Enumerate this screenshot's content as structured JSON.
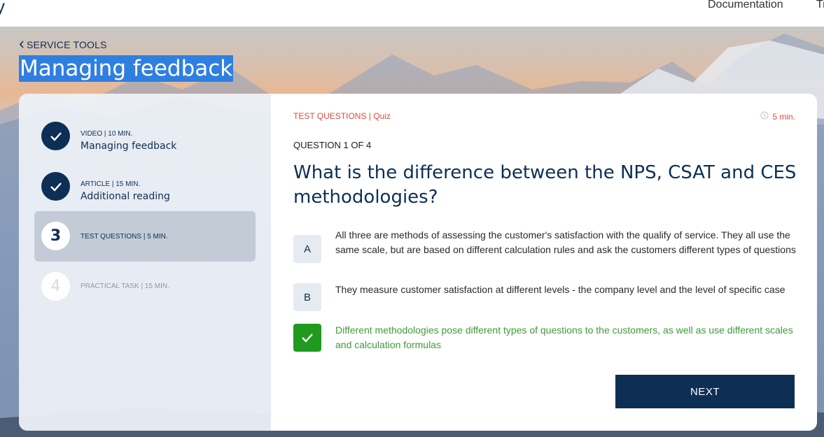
{
  "header": {
    "logo_fragment": "y",
    "nav_documentation": "Documentation",
    "nav_truncated": "Tr"
  },
  "breadcrumb": {
    "back_label": "SERVICE TOOLS"
  },
  "page_title": "Managing feedback",
  "steps": [
    {
      "number": "",
      "meta": "VIDEO | 10 MIN.",
      "title": "Managing feedback",
      "status": "done"
    },
    {
      "number": "",
      "meta": "ARTICLE | 15 MIN.",
      "title": "Additional reading",
      "status": "done"
    },
    {
      "number": "3",
      "meta": "TEST QUESTIONS | 5 MIN.",
      "title": "",
      "status": "current"
    },
    {
      "number": "4",
      "meta": "PRACTICAL TASK | 15 MIN.",
      "title": "",
      "status": "todo"
    }
  ],
  "quiz": {
    "label": "TEST QUESTIONS | Quiz",
    "time": "5 min.",
    "counter": "QUESTION 1 OF 4",
    "question": "What is the difference between the NPS, CSAT and CES methodologies?",
    "answers": [
      {
        "letter": "A",
        "text": "All three are methods of assessing the customer's satisfaction with the qualify of service. They all use the same scale, but are based on different calculation rules and ask the customers different types of questions",
        "selected": false
      },
      {
        "letter": "B",
        "text": "They measure customer satisfaction at different levels - the company level and the level of specific case",
        "selected": false
      },
      {
        "letter": "",
        "text": "Different methodologies pose different types of questions to the customers, as well as use different scales and calculation formulas",
        "selected": true
      }
    ],
    "next_label": "NEXT"
  },
  "colors": {
    "navy": "#0d2f55",
    "accent_red": "#e04a3d",
    "correct_green": "#1f9a1f",
    "title_highlight": "#2f7fe0"
  }
}
